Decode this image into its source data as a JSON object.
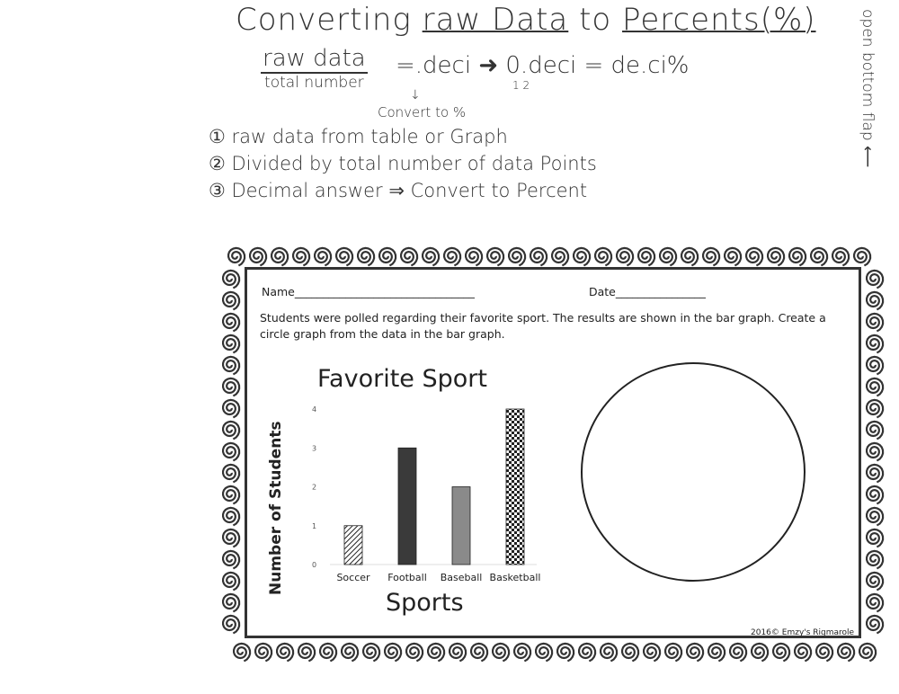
{
  "notes": {
    "title_prefix": "Converting",
    "title_raw": "raw Data",
    "title_to": "to",
    "title_percents": "Percents(%)",
    "fraction_numerator": "raw data",
    "fraction_denominator": "total number",
    "formula": "=.deci ➜ 0.deci = de.ci%",
    "formula_sub": "1 2",
    "arrow": "↓",
    "convert_note": "Convert to %",
    "steps": [
      "① raw data from table or Graph",
      "② Divided by total number of data Points",
      "③ Decimal answer ⇒ Convert to Percent"
    ],
    "flap_note": "open bottom flap ⟵"
  },
  "worksheet": {
    "name_label": "Name________________________________",
    "date_label": "Date________________",
    "instructions": "Students were polled regarding their favorite sport.  The results are shown in the bar graph.  Create a circle graph from the data in the bar graph.",
    "copyright": "2016© Emzy's Rigmarole"
  },
  "chart_data": {
    "type": "bar",
    "title": "Favorite Sport",
    "xlabel": "Sports",
    "ylabel": "Number of Students",
    "categories": [
      "Soccer",
      "Football",
      "Baseball",
      "Basketball"
    ],
    "values": [
      1,
      3,
      2,
      4
    ],
    "ylim": [
      0,
      4
    ],
    "yticks": [
      "0",
      "1",
      "2",
      "3",
      "4"
    ],
    "grid": false,
    "fills": [
      "diagonal-hatch",
      "#3a3a3a",
      "#8a8a8a",
      "checkerboard"
    ]
  },
  "empty_circle_graph": true
}
